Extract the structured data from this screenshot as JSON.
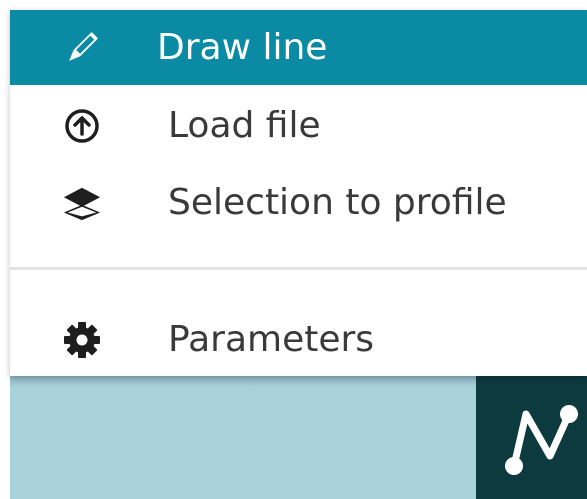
{
  "menu": {
    "items": [
      {
        "label": "Draw line",
        "icon": "pencil-icon",
        "active": true
      },
      {
        "label": "Load file",
        "icon": "upload-circle-icon",
        "active": false
      },
      {
        "label": "Selection to profile",
        "icon": "layers-icon",
        "active": false
      },
      {
        "label": "Parameters",
        "icon": "gear-icon",
        "active": false
      }
    ]
  },
  "colors": {
    "active_bg": "#0a8aa3",
    "active_text": "#ffffff",
    "text": "#3a3a3a",
    "map_bg": "#a9d2dd",
    "logo_bg": "#0d3a3f"
  },
  "logo": {
    "icon": "network-n-icon"
  }
}
